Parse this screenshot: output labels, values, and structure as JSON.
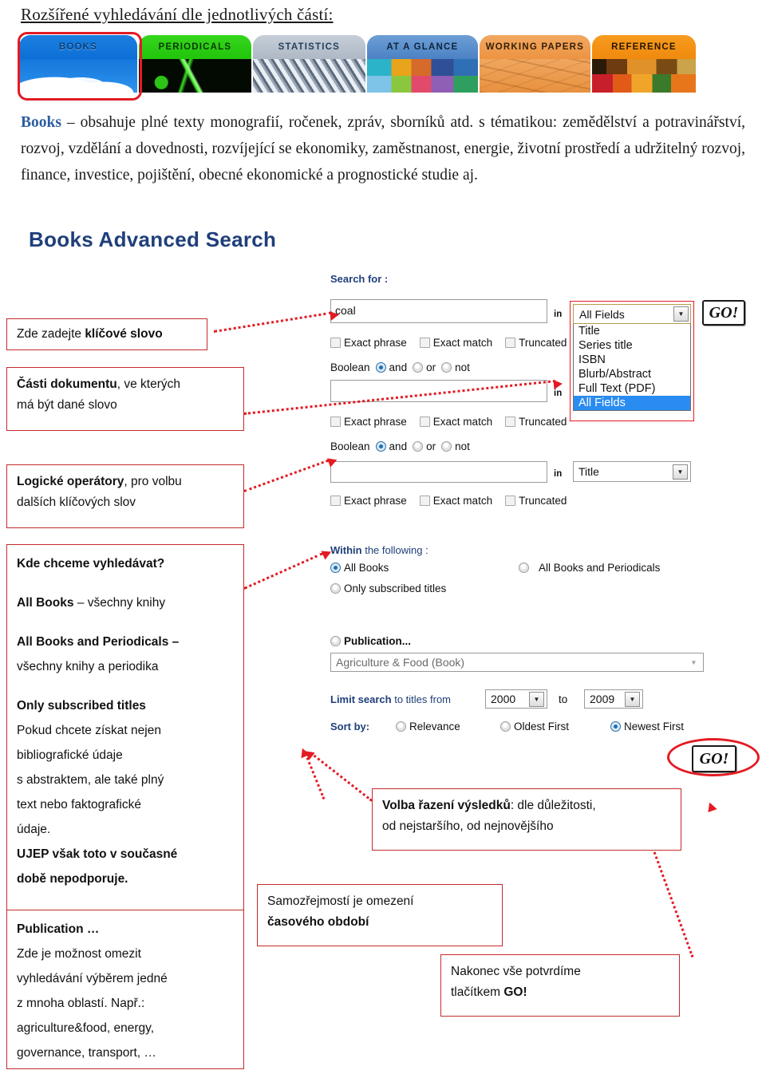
{
  "page": {
    "title": "Rozšířené vyhledávání dle jednotlivých částí:"
  },
  "tabs": [
    {
      "label": "BOOKS",
      "name": "tab-books",
      "selected": true
    },
    {
      "label": "PERIODICALS",
      "name": "tab-periodicals",
      "selected": false
    },
    {
      "label": "STATISTICS",
      "name": "tab-statistics",
      "selected": false
    },
    {
      "label": "AT A GLANCE",
      "name": "tab-glance",
      "selected": false
    },
    {
      "label": "WORKING PAPERS",
      "name": "tab-working",
      "selected": false
    },
    {
      "label": "REFERENCE",
      "name": "tab-reference",
      "selected": false
    }
  ],
  "intro": {
    "keyword": "Books",
    "body": " – obsahuje plné texty monografií, ročenek, zpráv, sborníků atd. s tématikou: zemědělství a potravinářství, rozvoj, vzdělání a dovednosti, rozvíjející se ekonomiky, zaměstnanost, energie, životní prostředí a udržitelný rozvoj, finance, investice, pojištění, obecné ekonomické a prognostické studie aj."
  },
  "form": {
    "heading": "Books Advanced Search",
    "search_for_label": "Search for :",
    "in_word": "in",
    "query_value": "coal",
    "query_placeholder": "",
    "query2_value": "",
    "field_select_1": "All Fields",
    "field_select_2": "Title",
    "field_select_3": "Title",
    "field_options": [
      "Title",
      "Series title",
      "ISBN",
      "Blurb/Abstract",
      "Full Text (PDF)",
      "All Fields"
    ],
    "field_options_selected": "All Fields",
    "checkboxes": [
      "Exact phrase",
      "Exact match",
      "Truncated"
    ],
    "boolean_label": "Boolean",
    "boolean_options": [
      "and",
      "or",
      "not"
    ],
    "boolean_selected": "and",
    "within_label_strong": "Within",
    "within_label_rest": " the following :",
    "within_options": [
      "All Books",
      "All Books and Periodicals",
      "Only subscribed titles",
      "Publication..."
    ],
    "within_selected": "All Books",
    "publication_value": "Agriculture & Food (Book)",
    "limit_label_strong": "Limit search",
    "limit_label_rest": " to titles from",
    "limit_to_word": "to",
    "year_from": "2000",
    "year_to": "2009",
    "sort_label": "Sort by:",
    "sort_options": [
      "Relevance",
      "Oldest First",
      "Newest First"
    ],
    "sort_selected": "Newest First",
    "go_label": "GO!"
  },
  "notes": {
    "keyword": {
      "line1_plain": "Zde zadejte ",
      "line1_bold": "klíčové slovo"
    },
    "parts": {
      "bold1": "Části dokumentu",
      "rest1": ", ve kterých",
      "line2": "má být dané slovo"
    },
    "boolean": {
      "bold1": "Logické operátory",
      "rest1": ", pro volbu",
      "line2": "dalších klíčových slov"
    },
    "where": {
      "title": "Kde chceme vyhledávat?",
      "b1": "All Books",
      "r1": " – všechny knihy",
      "b2": "All Books and Periodicals –",
      "r2": "všechny knihy a periodika",
      "b3": "Only subscribed titles",
      "r3a": "Pokud chcete získat nejen",
      "r3b": "bibliografické údaje",
      "r3c": "s abstraktem, ale také plný",
      "r3d": "text nebo faktografické",
      "r3e": "údaje.",
      "b4a": "UJEP však toto v současné",
      "b4b": "době nepodporuje."
    },
    "publication": {
      "bold": "Publication …",
      "l1": "Zde je možnost omezit",
      "l2": "vyhledávání výběrem jedné",
      "l3": "z mnoha oblastí. Např.:",
      "l4": "agriculture&food, energy,",
      "l5": "governance, transport, …"
    },
    "sorting": {
      "bold": "Volba řazení výsledků",
      "rest": ": dle důležitosti,",
      "line2": "od nejstaršího, od nejnovějšího"
    },
    "period": {
      "l1": "Samozřejmostí je omezení",
      "b2": "časového období"
    },
    "confirm": {
      "l1": "Nakonec vše potvrdíme",
      "l2a": "tlačítkem ",
      "l2b": "GO!"
    }
  },
  "colors": {
    "accent_red": "#e31b23",
    "note_border": "#c42b2b",
    "heading_blue": "#1f3f7a",
    "keyword_blue": "#2b5da0",
    "dropdown_sel": "#2a8cf0"
  }
}
